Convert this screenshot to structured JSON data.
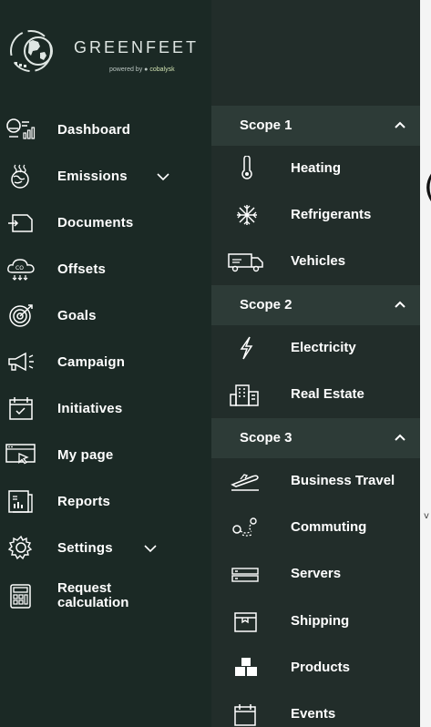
{
  "brand": {
    "name": "GREENFEET",
    "powered_by": "powered by",
    "powered_company": "cobalysk"
  },
  "nav": {
    "dashboard": "Dashboard",
    "emissions": "Emissions",
    "documents": "Documents",
    "offsets": "Offsets",
    "goals": "Goals",
    "campaign": "Campaign",
    "initiatives": "Initiatives",
    "my_page": "My page",
    "reports": "Reports",
    "settings": "Settings",
    "request_calculation_line1": "Request",
    "request_calculation_line2": "calculation"
  },
  "submenu": {
    "scope1": {
      "label": "Scope 1",
      "items": [
        "Heating",
        "Refrigerants",
        "Vehicles"
      ]
    },
    "scope2": {
      "label": "Scope 2",
      "items": [
        "Electricity",
        "Real Estate"
      ]
    },
    "scope3": {
      "label": "Scope 3",
      "items": [
        "Business Travel",
        "Commuting",
        "Servers",
        "Shipping",
        "Products",
        "Events"
      ]
    }
  },
  "colors": {
    "sidebar_bg": "#1b2925",
    "submenu_bg": "#222d2a",
    "scope_header_bg": "#2d3b37",
    "text": "#ffffff"
  }
}
